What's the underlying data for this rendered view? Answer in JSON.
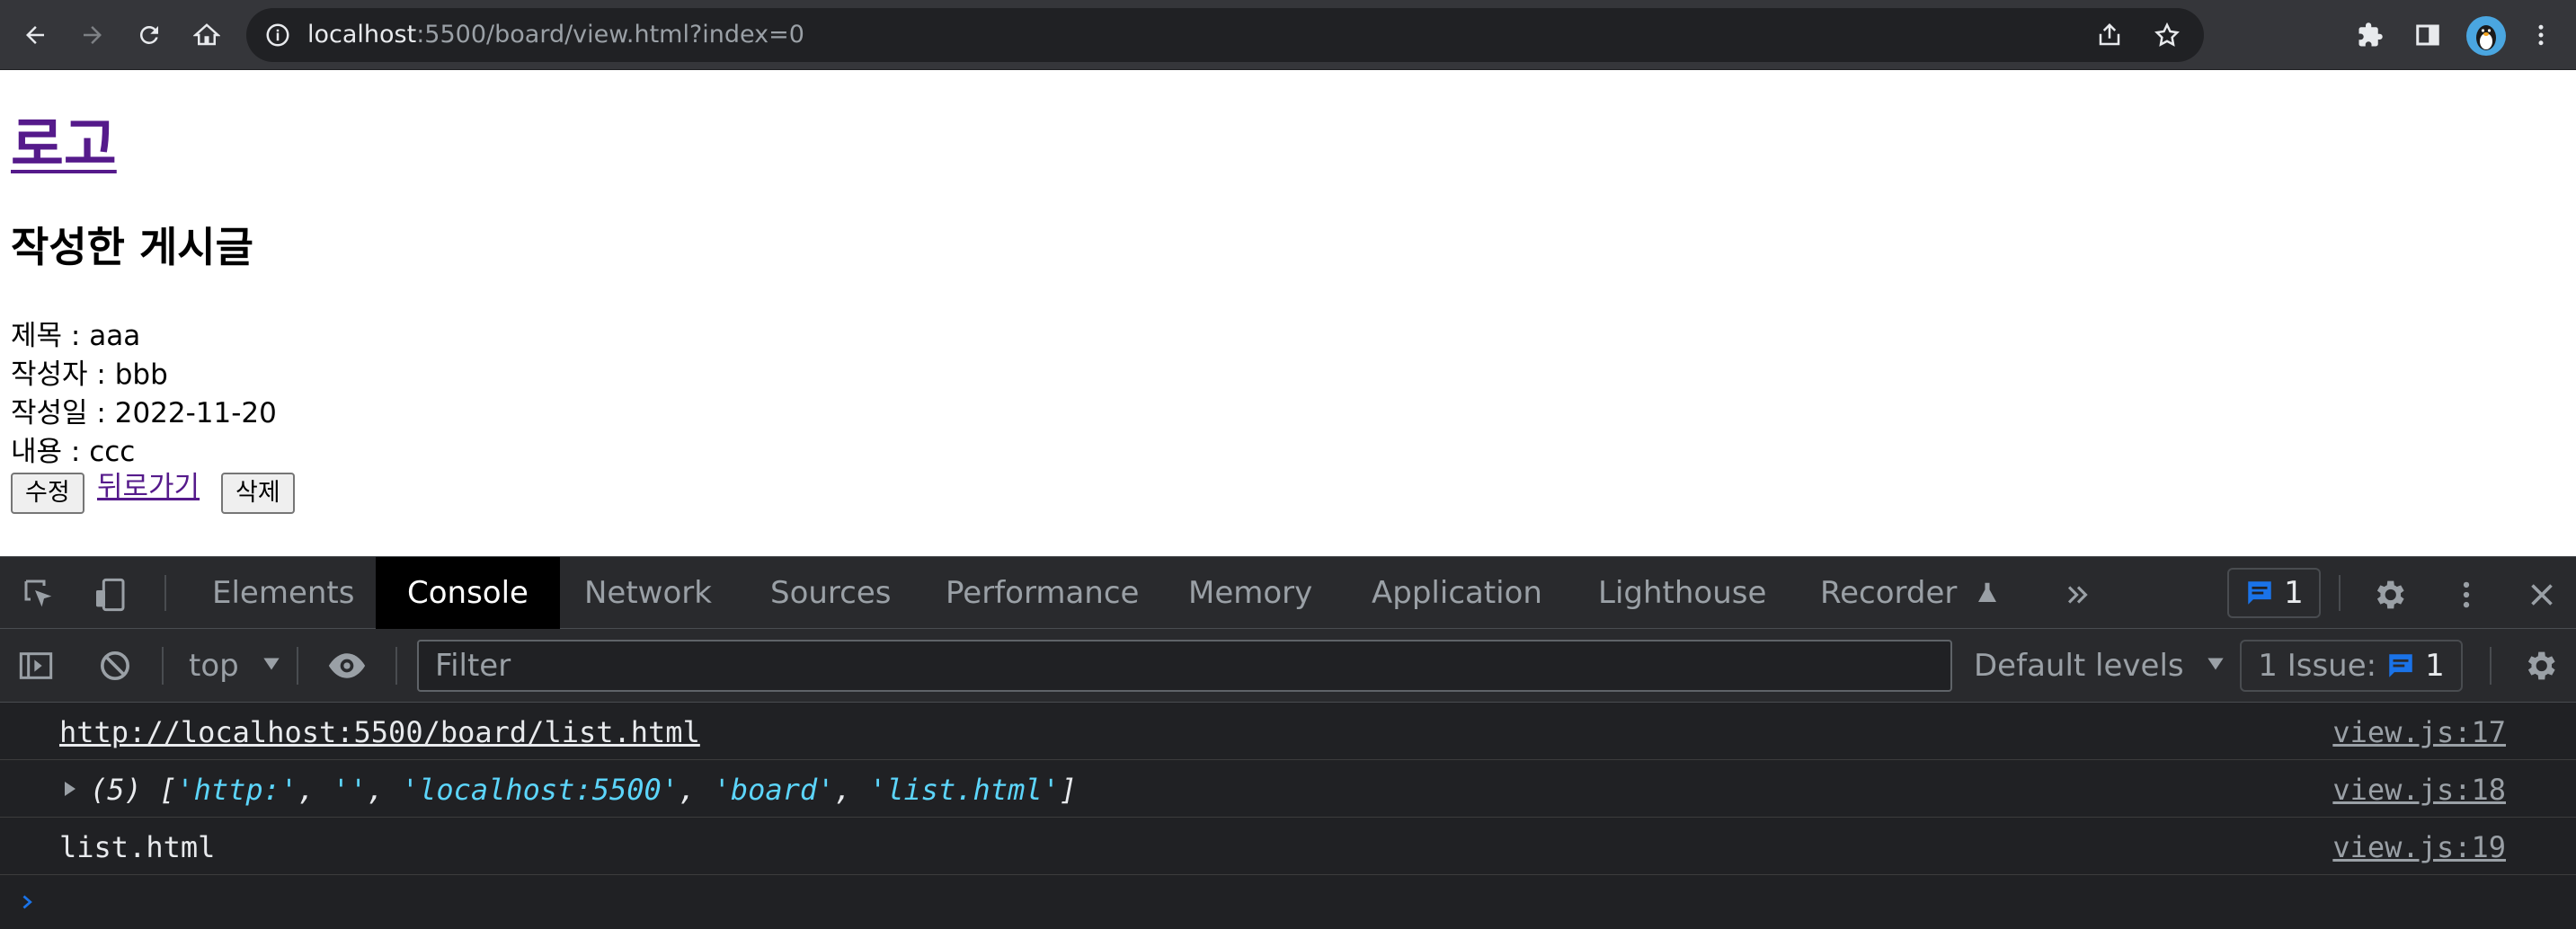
{
  "browser": {
    "url_host": "localhost",
    "url_rest": ":5500/board/view.html?index=0",
    "icons": [
      "back-icon",
      "forward-icon",
      "reload-icon",
      "home-icon",
      "info-icon",
      "share-icon",
      "star-icon",
      "extensions-icon",
      "sidepanel-icon",
      "avatar",
      "menu-icon"
    ]
  },
  "page": {
    "logo": "로고",
    "heading": "작성한 게시글",
    "fields": [
      {
        "label": "제목",
        "value": "aaa"
      },
      {
        "label": "작성자",
        "value": "bbb"
      },
      {
        "label": "작성일",
        "value": "2022-11-20"
      },
      {
        "label": "내용",
        "value": "ccc"
      }
    ],
    "separator": " : ",
    "edit_button": "수정",
    "back_link": "뒤로가기",
    "delete_button": "삭제"
  },
  "devtools": {
    "tabs": [
      "Elements",
      "Console",
      "Network",
      "Sources",
      "Performance",
      "Memory",
      "Application",
      "Lighthouse",
      "Recorder"
    ],
    "active_tab": "Console",
    "message_count": "1",
    "context": "top",
    "filter_placeholder": "Filter",
    "levels": "Default levels",
    "issues_label": "1 Issue:",
    "issues_count": "1",
    "console": [
      {
        "text": "http://localhost:5500/board/list.html",
        "source": "view.js:17"
      },
      {
        "prefix": "(5) [",
        "items": [
          "'http:'",
          "''",
          "'localhost:5500'",
          "'board'",
          "'list.html'"
        ],
        "suffix": "]",
        "source": "view.js:18"
      },
      {
        "text": "list.html",
        "source": "view.js:19"
      }
    ]
  },
  "colors": {
    "chrome_bg": "#35363a",
    "devtools_bg": "#202124",
    "link_visited": "#551a8b",
    "console_string": "#5cd5fb",
    "accent_blue": "#1a73e8"
  }
}
